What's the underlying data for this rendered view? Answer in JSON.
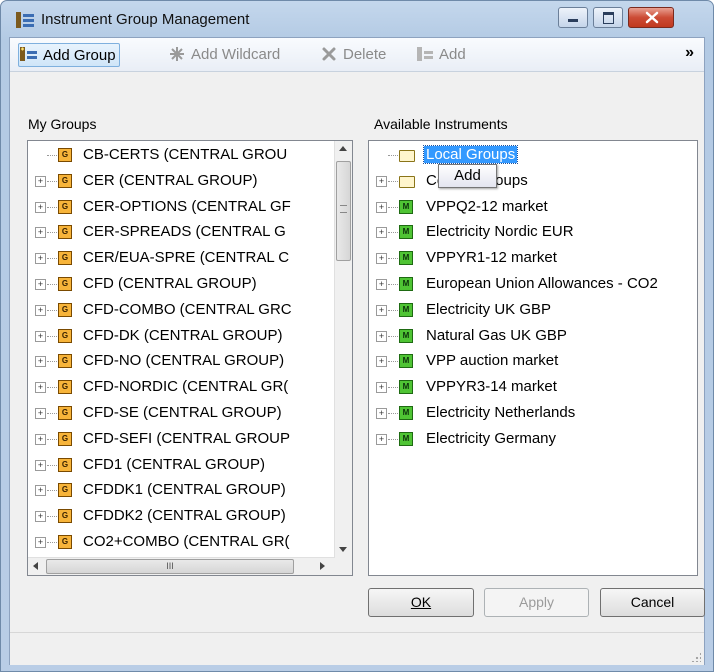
{
  "window": {
    "title": "Instrument Group Management"
  },
  "toolbar": {
    "add_group": "Add Group",
    "add_wildcard": "Add Wildcard",
    "delete": "Delete",
    "add": "Add",
    "overflow": "»"
  },
  "my_groups": {
    "label": "My Groups",
    "items": [
      "CB-CERTS (CENTRAL GROU",
      "CER (CENTRAL GROUP)",
      "CER-OPTIONS (CENTRAL GF",
      "CER-SPREADS (CENTRAL G",
      "CER/EUA-SPRE (CENTRAL C",
      "CFD (CENTRAL GROUP)",
      "CFD-COMBO (CENTRAL GRC",
      "CFD-DK (CENTRAL GROUP)",
      "CFD-NO (CENTRAL GROUP)",
      "CFD-NORDIC (CENTRAL GR(",
      "CFD-SE (CENTRAL GROUP)",
      "CFD-SEFI (CENTRAL GROUP",
      "CFD1 (CENTRAL GROUP)",
      "CFDDK1 (CENTRAL GROUP)",
      "CFDDK2 (CENTRAL GROUP)",
      "CO2+COMBO (CENTRAL GR("
    ],
    "hscroll_glyph": "III"
  },
  "available": {
    "label": "Available Instruments",
    "items": [
      {
        "text": "Local Groups",
        "type": "folder",
        "selected": true
      },
      {
        "text": "Central Groups",
        "type": "folder"
      },
      {
        "text": "VPPQ2-12 market",
        "type": "market"
      },
      {
        "text": "Electricity Nordic EUR",
        "type": "market"
      },
      {
        "text": "VPPYR1-12 market",
        "type": "market"
      },
      {
        "text": "European Union Allowances - CO2",
        "type": "market"
      },
      {
        "text": "Electricity UK GBP",
        "type": "market"
      },
      {
        "text": "Natural Gas UK GBP",
        "type": "market"
      },
      {
        "text": "VPP auction market",
        "type": "market"
      },
      {
        "text": "VPPYR3-14 market",
        "type": "market"
      },
      {
        "text": "Electricity Netherlands",
        "type": "market"
      },
      {
        "text": "Electricity Germany",
        "type": "market"
      }
    ]
  },
  "tooltip": {
    "text": "Add"
  },
  "buttons": {
    "ok": "OK",
    "apply": "Apply",
    "cancel": "Cancel"
  },
  "icons": {
    "group_letter": "G",
    "market_letter": "M"
  },
  "colors": {
    "selection": "#3399ff",
    "accent": "#cfe5f8"
  }
}
